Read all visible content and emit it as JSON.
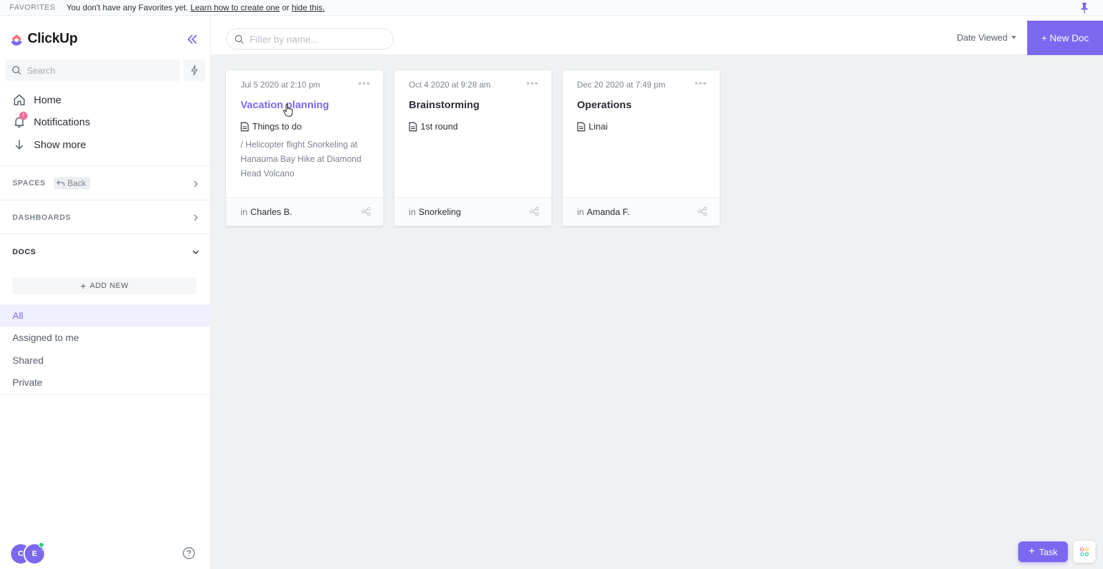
{
  "favorites_bar": {
    "title": "FAVORITES",
    "message": "You don't have any Favorites yet.",
    "learn_link": "Learn how to create one",
    "or_text": "or",
    "hide_link": "hide this."
  },
  "sidebar": {
    "logo_text": "ClickUp",
    "search_placeholder": "Search",
    "nav": [
      {
        "label": "Home",
        "icon": "home-icon"
      },
      {
        "label": "Notifications",
        "icon": "bell-icon",
        "badge": "!"
      },
      {
        "label": "Show more",
        "icon": "arrow-down-icon"
      }
    ],
    "spaces_label": "SPACES",
    "back_label": "Back",
    "dashboards_label": "DASHBOARDS",
    "docs_label": "DOCS",
    "add_new_label": "ADD NEW",
    "doc_filters": [
      "All",
      "Assigned to me",
      "Shared",
      "Private"
    ],
    "active_filter": "All",
    "avatars": [
      "C",
      "E"
    ]
  },
  "toolbar": {
    "filter_placeholder": "Filter by name...",
    "sort_label": "Date Viewed",
    "new_doc_label": "+ New Doc"
  },
  "docs": [
    {
      "date": "Jul 5 2020 at 2:10 pm",
      "title": "Vacation planning",
      "subpage": "Things to do",
      "preview": "/ Helicopter flight Snorkeling at Hanauma Bay Hike at Diamond Head Volcano",
      "in_prefix": "in",
      "location": "Charles B."
    },
    {
      "date": "Oct 4 2020 at 9:28 am",
      "title": "Brainstorming",
      "subpage": "1st round",
      "preview": "",
      "in_prefix": "in",
      "location": "Snorkeling"
    },
    {
      "date": "Dec 20 2020 at 7:49 pm",
      "title": "Operations",
      "subpage": "Linai",
      "preview": "",
      "in_prefix": "in",
      "location": "Amanda F."
    }
  ],
  "floating": {
    "task_label": "Task"
  },
  "colors": {
    "accent": "#7b68ee",
    "notification": "#f06d9a",
    "online": "#2ecd6f"
  }
}
